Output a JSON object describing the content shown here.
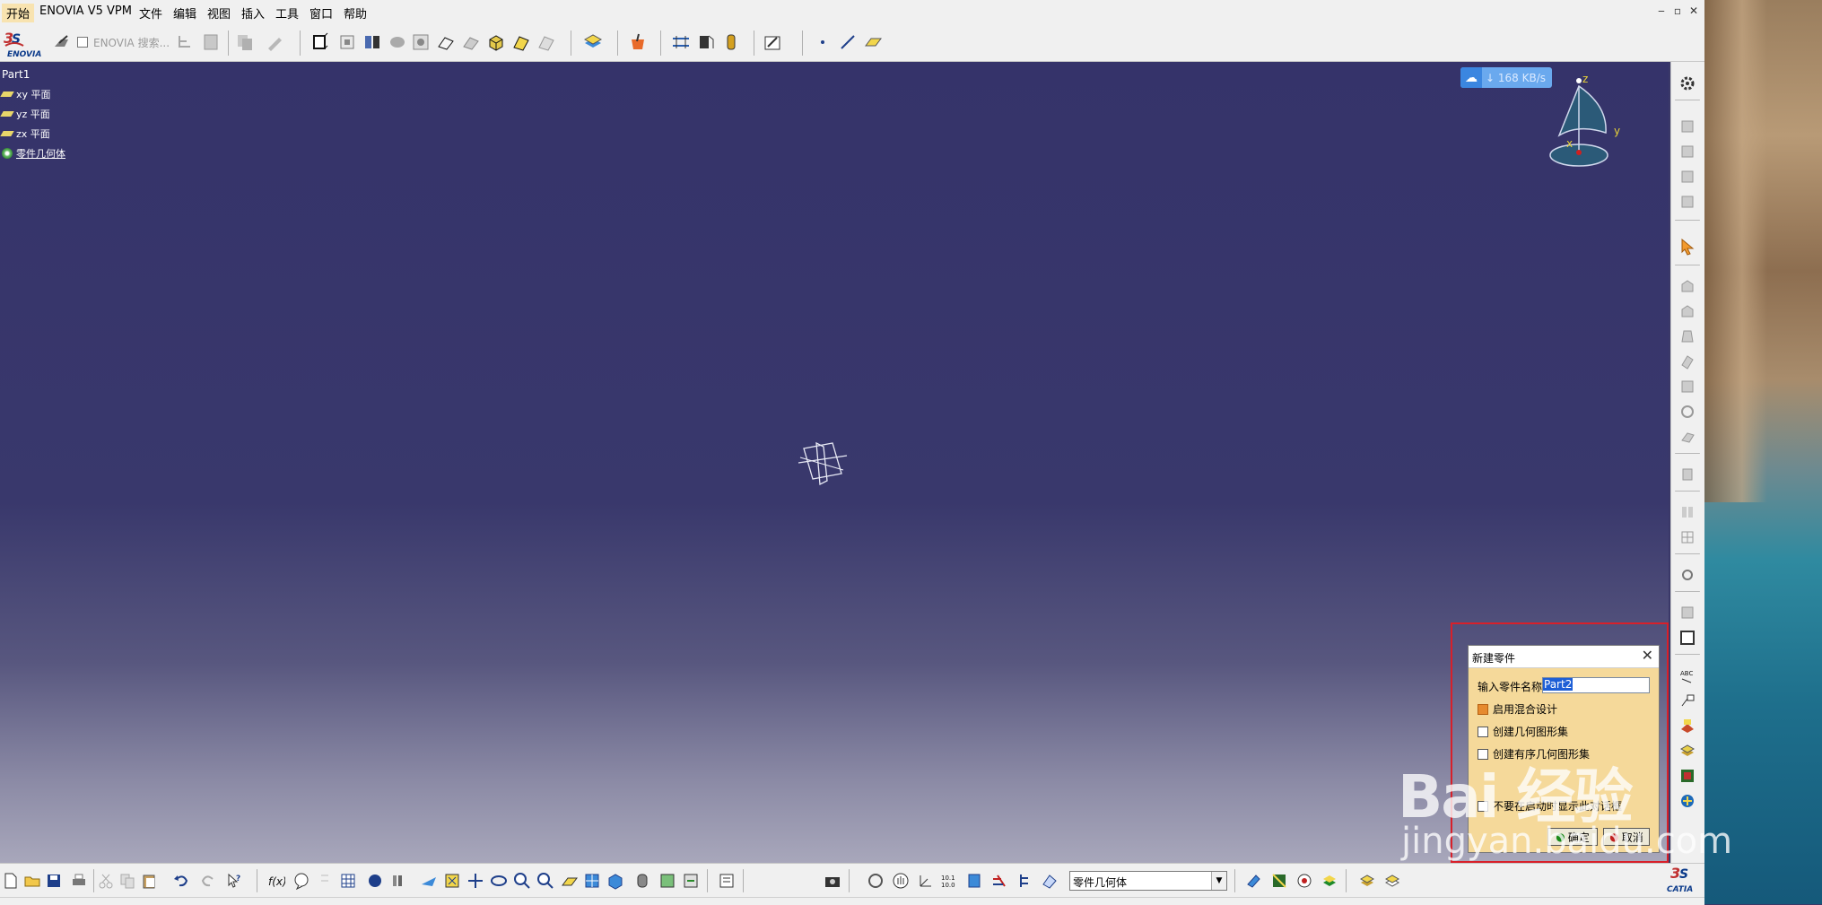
{
  "menubar": {
    "items": [
      "开始",
      "ENOVIA V5 VPM",
      "文件",
      "编辑",
      "视图",
      "插入",
      "工具",
      "窗口",
      "帮助"
    ]
  },
  "toolbar": {
    "enovia_logo_text": "ENOVIA",
    "enovia_search_label": "ENOVIA 搜索..."
  },
  "tree": {
    "root": "Part1",
    "items": [
      {
        "label": "xy 平面",
        "icon": "plane-icon"
      },
      {
        "label": "yz 平面",
        "icon": "plane-icon"
      },
      {
        "label": "zx 平面",
        "icon": "plane-icon"
      },
      {
        "label": "零件几何体",
        "icon": "part-body-icon"
      }
    ]
  },
  "speed_badge": {
    "text": "↓ 168 KB/s"
  },
  "compass": {
    "z_label": "z",
    "y_label": "y",
    "x_label": "x"
  },
  "dialog": {
    "title": "新建零件",
    "close_glyph": "✕",
    "name_label": "输入零件名称",
    "name_value": "Part2",
    "hybrid_label": "启用混合设计",
    "geo_set_label": "创建几何图形集",
    "ordered_geo_set_label": "创建有序几何图形集",
    "no_show_label": "不要在启动时显示此对话框",
    "ok_label": "确定",
    "cancel_label": "取消",
    "hybrid_checked": true,
    "geo_set_checked": false,
    "ordered_geo_set_checked": false,
    "no_show_checked": false
  },
  "bottom": {
    "body_select_value": "零件几何体",
    "catia_logo_text": "CATIA"
  },
  "watermark": {
    "big": "Bai 经验",
    "small": "jingyan.baidu.com"
  },
  "colors": {
    "viewport_top": "#35336a",
    "viewport_bottom": "#a8a7bb",
    "dialog_bg": "#f5d99a",
    "highlight_frame": "#d8202a",
    "speed_badge": "#6aa9ee"
  }
}
